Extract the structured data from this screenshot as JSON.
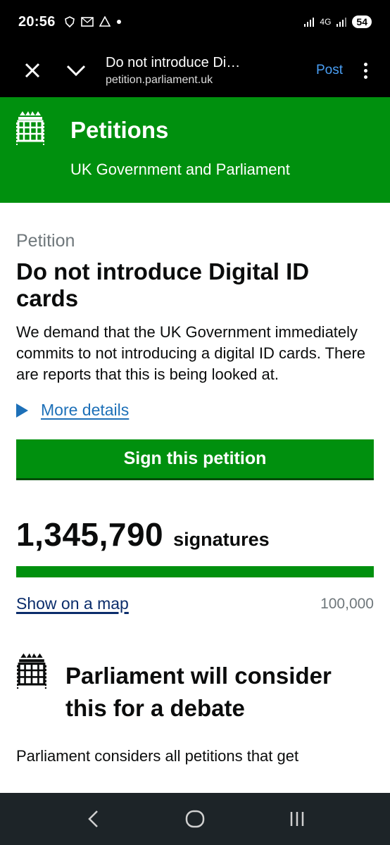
{
  "status_bar": {
    "time": "20:56",
    "network": "4G",
    "battery": "54"
  },
  "browser": {
    "title": "Do not introduce Di…",
    "url": "petition.parliament.uk",
    "post_label": "Post"
  },
  "header": {
    "site_name": "Petitions",
    "subtitle": "UK Government and Parliament"
  },
  "petition": {
    "caption": "Petition",
    "title": "Do not introduce Digital ID cards",
    "description": "We demand that the UK Government immediately commits to not introducing a digital ID cards. There are reports that this is being looked at.",
    "more_details": "More details",
    "sign_label": "Sign this petition",
    "signature_count": "1,345,790",
    "signature_label": "signatures",
    "progress": 1.0,
    "map_link": "Show on a map",
    "threshold": "100,000"
  },
  "debate": {
    "title": "Parliament will consider this for a debate",
    "text": "Parliament considers all petitions that get"
  },
  "colors": {
    "brand_green": "#00900e",
    "link_blue": "#1d70b8"
  }
}
